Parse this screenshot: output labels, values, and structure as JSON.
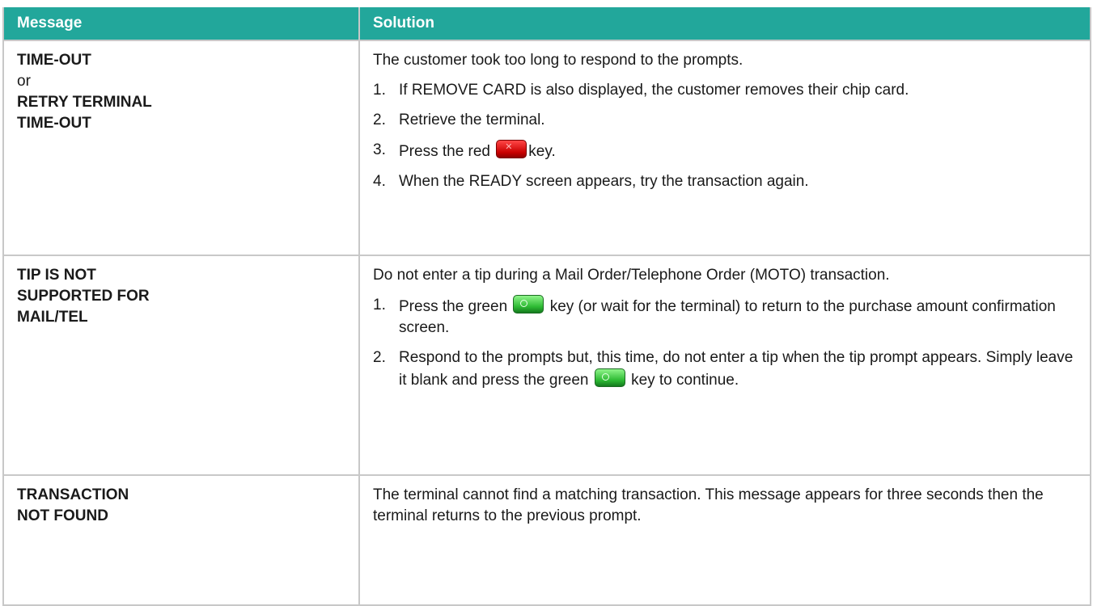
{
  "table": {
    "headers": {
      "message": "Message",
      "solution": "Solution"
    },
    "rows": [
      {
        "message": {
          "line1": "TIME-OUT",
          "or": "or",
          "line2": "RETRY TERMINAL",
          "line3": "TIME-OUT"
        },
        "solution": {
          "intro": "The customer took too long to respond to the prompts.",
          "steps": [
            {
              "num": "1.",
              "text": "If REMOVE CARD is also displayed, the customer removes their chip card."
            },
            {
              "num": "2.",
              "text": "Retrieve the terminal."
            },
            {
              "num": "3.",
              "before": "Press the red",
              "key": "red-cancel-key-icon",
              "after": "key."
            },
            {
              "num": "4.",
              "text": "When the READY screen appears, try the transaction again."
            }
          ]
        }
      },
      {
        "message": {
          "line1": "TIP IS NOT",
          "line2": "SUPPORTED FOR",
          "line3": "MAIL/TEL"
        },
        "solution": {
          "intro": "Do not enter a tip during a Mail Order/Telephone Order (MOTO) transaction.",
          "steps": [
            {
              "num": "1.",
              "before": "Press the green",
              "key": "green-ok-key-icon",
              "after": "key (or wait for the terminal) to return to the purchase amount confirmation screen."
            },
            {
              "num": "2.",
              "before": "Respond to the prompts but, this time, do not enter a tip when the tip prompt appears. Simply leave it blank and press the green",
              "key": "green-ok-key-icon",
              "after": "key to continue."
            }
          ]
        }
      },
      {
        "message": {
          "line1": "TRANSACTION",
          "line2": "NOT FOUND"
        },
        "solution": {
          "intro": "The terminal cannot find a matching transaction. This message appears for three seconds then the terminal returns to the previous prompt."
        }
      }
    ]
  },
  "colors": {
    "header_bg": "#22a79b",
    "header_text": "#ffffff",
    "border": "#c8c8c8",
    "red_key": "#d40000",
    "green_key": "#2dba33"
  }
}
